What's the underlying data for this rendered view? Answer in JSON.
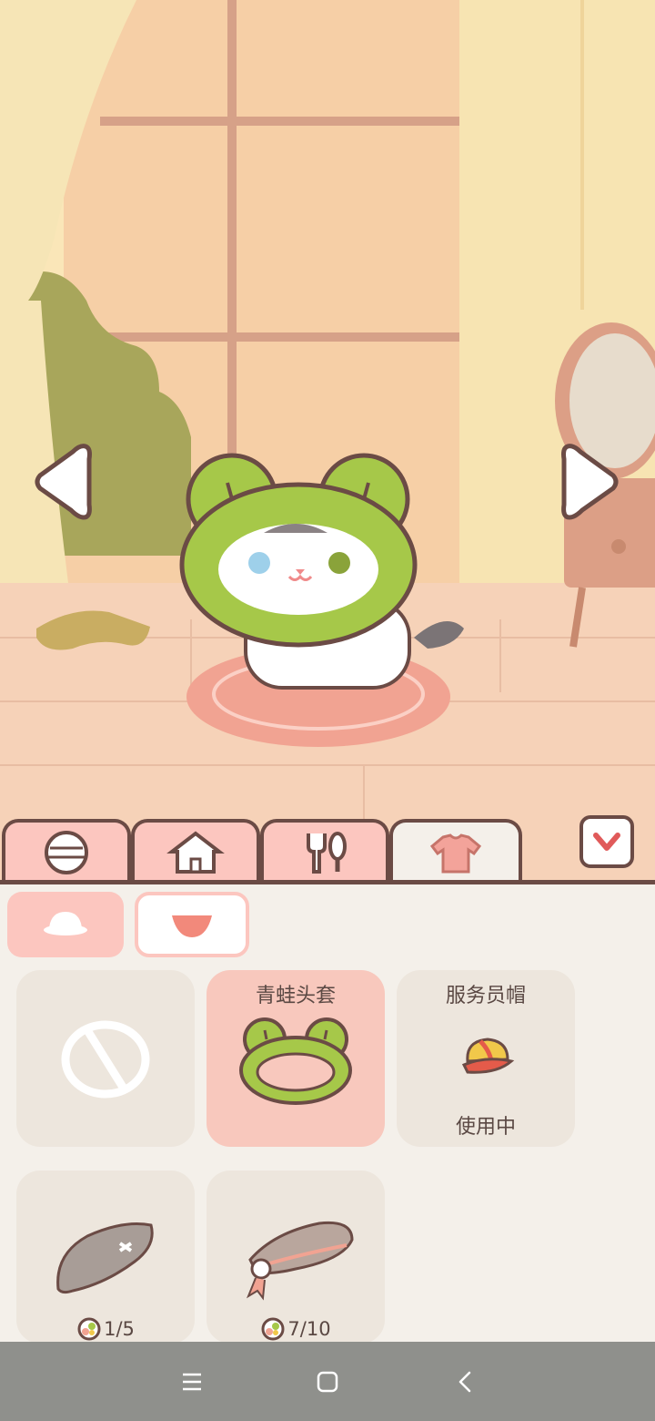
{
  "scene": {
    "cat_name": "",
    "arrows": {
      "prev": "previous-cat",
      "next": "next-cat"
    }
  },
  "tabs": [
    {
      "id": "yarn",
      "icon": "yarn-ball-icon",
      "active": false
    },
    {
      "id": "home",
      "icon": "house-icon",
      "active": false
    },
    {
      "id": "food",
      "icon": "fork-spoon-icon",
      "active": false
    },
    {
      "id": "outfit",
      "icon": "shirt-icon",
      "active": true
    }
  ],
  "collapse_icon": "chevron-down-icon",
  "subtabs": [
    {
      "id": "hats",
      "icon": "hat-icon",
      "active": true
    },
    {
      "id": "neck",
      "icon": "bib-icon",
      "active": false
    }
  ],
  "items": [
    {
      "title": "",
      "status": "",
      "price": "",
      "icon": "none-icon",
      "selected": false
    },
    {
      "title": "青蛙头套",
      "status": "",
      "price": "",
      "icon": "frog-hood-icon",
      "selected": true
    },
    {
      "title": "服务员帽",
      "status": "使用中",
      "price": "",
      "icon": "waiter-cap-icon",
      "selected": false
    },
    {
      "title": "",
      "status": "",
      "price": "1/5",
      "icon": "beret-icon",
      "selected": false
    },
    {
      "title": "",
      "status": "",
      "price": "7/10",
      "icon": "headband-icon",
      "selected": false
    }
  ],
  "colors": {
    "accent": "#fcc6bf",
    "outline": "#6b4b45",
    "frog_green": "#a6c849",
    "panel": "#f4f0ea"
  },
  "navbar": {
    "icons": [
      "menu-icon",
      "home-square-icon",
      "back-icon"
    ]
  }
}
